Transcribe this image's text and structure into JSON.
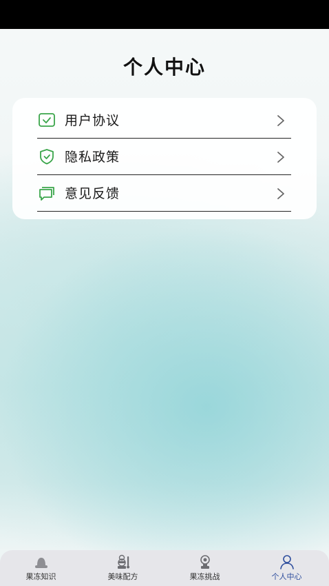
{
  "header": {
    "title": "个人中心"
  },
  "menu": {
    "items": [
      {
        "label": "用户协议",
        "icon": "checkbox-icon"
      },
      {
        "label": "隐私政策",
        "icon": "shield-icon"
      },
      {
        "label": "意见反馈",
        "icon": "chat-icon"
      }
    ]
  },
  "tabbar": {
    "items": [
      {
        "label": "果冻知识",
        "icon": "hat-icon",
        "active": false
      },
      {
        "label": "美味配方",
        "icon": "chef-icon",
        "active": false
      },
      {
        "label": "果冻挑战",
        "icon": "trophy-icon",
        "active": false
      },
      {
        "label": "个人中心",
        "icon": "person-icon",
        "active": true
      }
    ]
  },
  "colors": {
    "accent_green": "#3aa54a",
    "tab_active": "#2c4c9c",
    "status_bar": "#000000"
  }
}
